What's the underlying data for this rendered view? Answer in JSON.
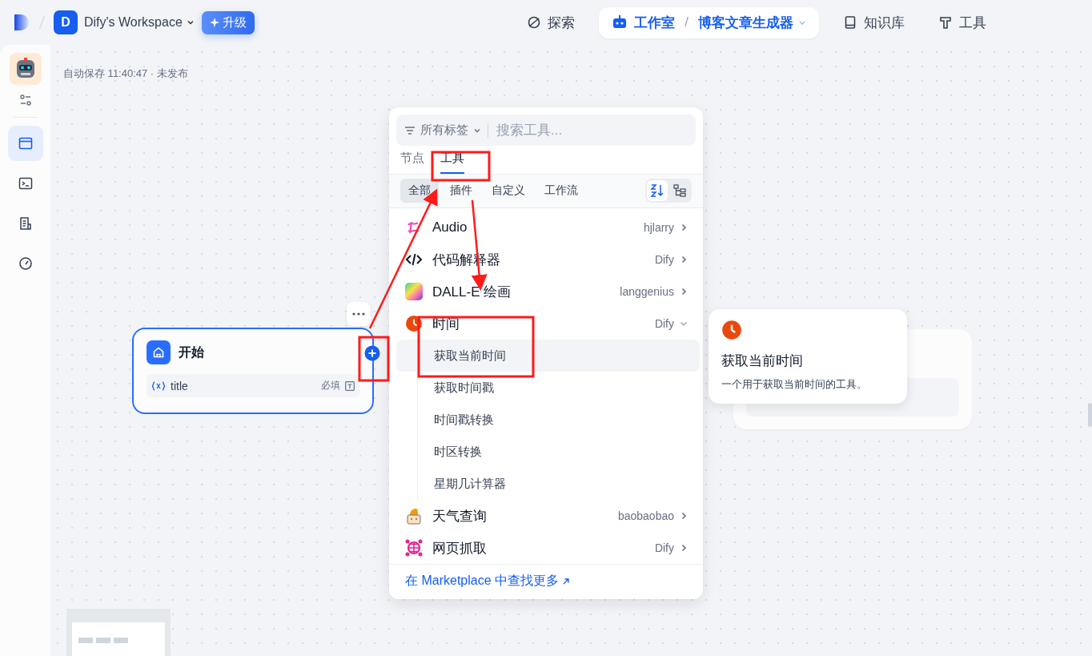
{
  "top_bar": {
    "workspace_initial": "D",
    "workspace_name": "Dify's Workspace",
    "upgrade": "升级",
    "nav": [
      {
        "label": "探索",
        "kind": "explore",
        "selected": false
      },
      {
        "label": "工作室",
        "kind": "studio",
        "selected": true,
        "separator": "/",
        "app": "博客文章生成器"
      },
      {
        "label": "知识库",
        "kind": "knowledge",
        "selected": false
      },
      {
        "label": "工具",
        "kind": "tools",
        "selected": false
      }
    ]
  },
  "sidebar": {
    "items": [
      {
        "kind": "orchestrate",
        "selected": true
      },
      {
        "kind": "api",
        "selected": false
      },
      {
        "kind": "logs",
        "selected": false
      },
      {
        "kind": "monitor",
        "selected": false
      }
    ]
  },
  "status": "自动保存 11:40:47 · 未发布",
  "start_node": {
    "title": "开始",
    "variables": [
      {
        "name": "title",
        "badge": "必填"
      }
    ]
  },
  "picker": {
    "tag_filter": "所有标签",
    "search_placeholder": "搜索工具...",
    "tabs": [
      {
        "label": "节点",
        "selected": false
      },
      {
        "label": "工具",
        "selected": true
      }
    ],
    "categories": [
      {
        "label": "全部",
        "selected": true
      },
      {
        "label": "插件",
        "selected": false
      },
      {
        "label": "自定义",
        "selected": false
      },
      {
        "label": "工作流",
        "selected": false
      }
    ],
    "view_modes": [
      {
        "kind": "sort",
        "selected": true
      },
      {
        "kind": "tree",
        "selected": false
      }
    ],
    "tools": [
      {
        "name": "Audio",
        "provider": "hjlarry",
        "kind": "audio",
        "expanded": false
      },
      {
        "name": "代码解释器",
        "provider": "Dify",
        "kind": "code",
        "expanded": false
      },
      {
        "name": "DALL-E 绘画",
        "provider": "langgenius",
        "kind": "dalle",
        "expanded": false
      },
      {
        "name": "时间",
        "provider": "Dify",
        "kind": "clock",
        "expanded": true,
        "children": [
          {
            "name": "获取当前时间",
            "selected": true
          },
          {
            "name": "获取时间戳",
            "selected": false
          },
          {
            "name": "时间戳转换",
            "selected": false
          },
          {
            "name": "时区转换",
            "selected": false
          },
          {
            "name": "星期几计算器",
            "selected": false
          }
        ]
      },
      {
        "name": "天气查询",
        "provider": "baobaobao",
        "kind": "weather",
        "expanded": false
      },
      {
        "name": "网页抓取",
        "provider": "Dify",
        "kind": "web",
        "expanded": false
      }
    ],
    "footer_link": "在 Marketplace 中查找更多"
  },
  "tooltip": {
    "title": "获取当前时间",
    "description": "一个用于获取当前时间的工具。"
  }
}
